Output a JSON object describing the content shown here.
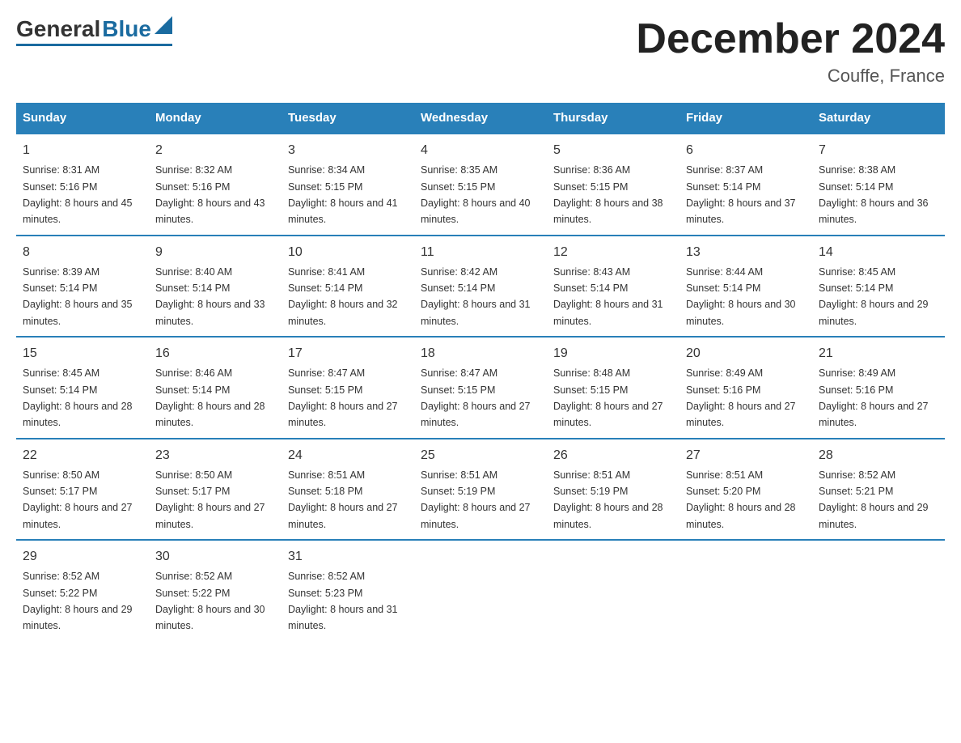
{
  "logo": {
    "general": "General",
    "blue": "Blue"
  },
  "title": "December 2024",
  "location": "Couffe, France",
  "days_of_week": [
    "Sunday",
    "Monday",
    "Tuesday",
    "Wednesday",
    "Thursday",
    "Friday",
    "Saturday"
  ],
  "weeks": [
    [
      {
        "day": "1",
        "sunrise": "8:31 AM",
        "sunset": "5:16 PM",
        "daylight": "8 hours and 45 minutes."
      },
      {
        "day": "2",
        "sunrise": "8:32 AM",
        "sunset": "5:16 PM",
        "daylight": "8 hours and 43 minutes."
      },
      {
        "day": "3",
        "sunrise": "8:34 AM",
        "sunset": "5:15 PM",
        "daylight": "8 hours and 41 minutes."
      },
      {
        "day": "4",
        "sunrise": "8:35 AM",
        "sunset": "5:15 PM",
        "daylight": "8 hours and 40 minutes."
      },
      {
        "day": "5",
        "sunrise": "8:36 AM",
        "sunset": "5:15 PM",
        "daylight": "8 hours and 38 minutes."
      },
      {
        "day": "6",
        "sunrise": "8:37 AM",
        "sunset": "5:14 PM",
        "daylight": "8 hours and 37 minutes."
      },
      {
        "day": "7",
        "sunrise": "8:38 AM",
        "sunset": "5:14 PM",
        "daylight": "8 hours and 36 minutes."
      }
    ],
    [
      {
        "day": "8",
        "sunrise": "8:39 AM",
        "sunset": "5:14 PM",
        "daylight": "8 hours and 35 minutes."
      },
      {
        "day": "9",
        "sunrise": "8:40 AM",
        "sunset": "5:14 PM",
        "daylight": "8 hours and 33 minutes."
      },
      {
        "day": "10",
        "sunrise": "8:41 AM",
        "sunset": "5:14 PM",
        "daylight": "8 hours and 32 minutes."
      },
      {
        "day": "11",
        "sunrise": "8:42 AM",
        "sunset": "5:14 PM",
        "daylight": "8 hours and 31 minutes."
      },
      {
        "day": "12",
        "sunrise": "8:43 AM",
        "sunset": "5:14 PM",
        "daylight": "8 hours and 31 minutes."
      },
      {
        "day": "13",
        "sunrise": "8:44 AM",
        "sunset": "5:14 PM",
        "daylight": "8 hours and 30 minutes."
      },
      {
        "day": "14",
        "sunrise": "8:45 AM",
        "sunset": "5:14 PM",
        "daylight": "8 hours and 29 minutes."
      }
    ],
    [
      {
        "day": "15",
        "sunrise": "8:45 AM",
        "sunset": "5:14 PM",
        "daylight": "8 hours and 28 minutes."
      },
      {
        "day": "16",
        "sunrise": "8:46 AM",
        "sunset": "5:14 PM",
        "daylight": "8 hours and 28 minutes."
      },
      {
        "day": "17",
        "sunrise": "8:47 AM",
        "sunset": "5:15 PM",
        "daylight": "8 hours and 27 minutes."
      },
      {
        "day": "18",
        "sunrise": "8:47 AM",
        "sunset": "5:15 PM",
        "daylight": "8 hours and 27 minutes."
      },
      {
        "day": "19",
        "sunrise": "8:48 AM",
        "sunset": "5:15 PM",
        "daylight": "8 hours and 27 minutes."
      },
      {
        "day": "20",
        "sunrise": "8:49 AM",
        "sunset": "5:16 PM",
        "daylight": "8 hours and 27 minutes."
      },
      {
        "day": "21",
        "sunrise": "8:49 AM",
        "sunset": "5:16 PM",
        "daylight": "8 hours and 27 minutes."
      }
    ],
    [
      {
        "day": "22",
        "sunrise": "8:50 AM",
        "sunset": "5:17 PM",
        "daylight": "8 hours and 27 minutes."
      },
      {
        "day": "23",
        "sunrise": "8:50 AM",
        "sunset": "5:17 PM",
        "daylight": "8 hours and 27 minutes."
      },
      {
        "day": "24",
        "sunrise": "8:51 AM",
        "sunset": "5:18 PM",
        "daylight": "8 hours and 27 minutes."
      },
      {
        "day": "25",
        "sunrise": "8:51 AM",
        "sunset": "5:19 PM",
        "daylight": "8 hours and 27 minutes."
      },
      {
        "day": "26",
        "sunrise": "8:51 AM",
        "sunset": "5:19 PM",
        "daylight": "8 hours and 28 minutes."
      },
      {
        "day": "27",
        "sunrise": "8:51 AM",
        "sunset": "5:20 PM",
        "daylight": "8 hours and 28 minutes."
      },
      {
        "day": "28",
        "sunrise": "8:52 AM",
        "sunset": "5:21 PM",
        "daylight": "8 hours and 29 minutes."
      }
    ],
    [
      {
        "day": "29",
        "sunrise": "8:52 AM",
        "sunset": "5:22 PM",
        "daylight": "8 hours and 29 minutes."
      },
      {
        "day": "30",
        "sunrise": "8:52 AM",
        "sunset": "5:22 PM",
        "daylight": "8 hours and 30 minutes."
      },
      {
        "day": "31",
        "sunrise": "8:52 AM",
        "sunset": "5:23 PM",
        "daylight": "8 hours and 31 minutes."
      },
      {
        "day": "",
        "sunrise": "",
        "sunset": "",
        "daylight": ""
      },
      {
        "day": "",
        "sunrise": "",
        "sunset": "",
        "daylight": ""
      },
      {
        "day": "",
        "sunrise": "",
        "sunset": "",
        "daylight": ""
      },
      {
        "day": "",
        "sunrise": "",
        "sunset": "",
        "daylight": ""
      }
    ]
  ]
}
